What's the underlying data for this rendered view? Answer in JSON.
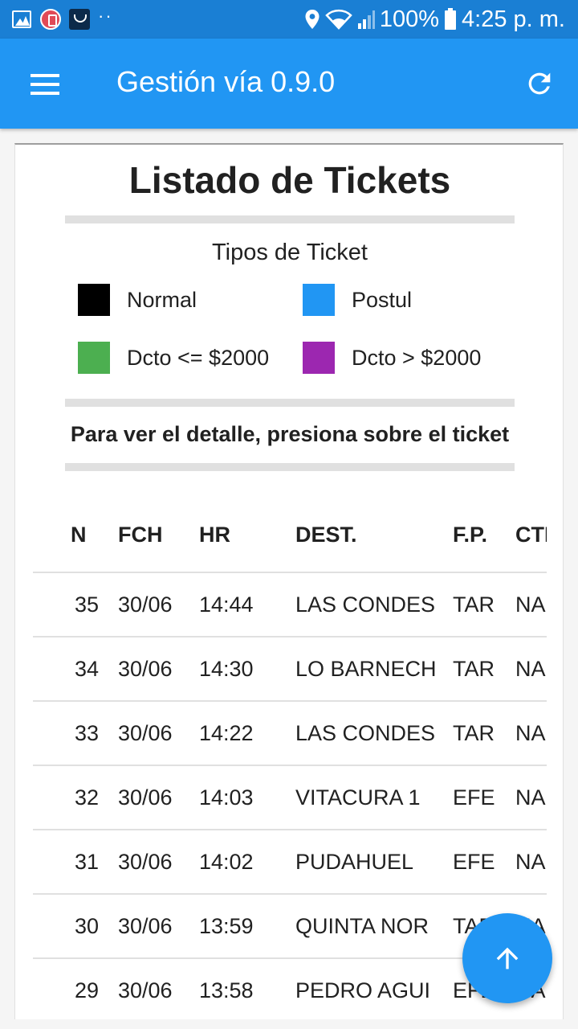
{
  "status_bar": {
    "battery": "100%",
    "time": "4:25 p. m.",
    "icons": [
      "image-icon",
      "notification-app-icon",
      "bag-app-icon",
      "more-dots-icon",
      "location-icon",
      "wifi-icon",
      "signal-icon",
      "battery-icon"
    ]
  },
  "app_bar": {
    "title": "Gestión vía 0.9.0",
    "menu_icon": "hamburger-icon",
    "refresh_icon": "refresh-icon"
  },
  "page": {
    "title": "Listado de Tickets",
    "types_title": "Tipos de Ticket",
    "instruction": "Para ver el detalle, presiona sobre el ticket"
  },
  "legend": [
    {
      "label": "Normal",
      "color": "#000000"
    },
    {
      "label": "Postul",
      "color": "#2196f3"
    },
    {
      "label": "Dcto <= $2000",
      "color": "#4caf50"
    },
    {
      "label": "Dcto > $2000",
      "color": "#9c27b0"
    }
  ],
  "table": {
    "headers": {
      "n": "N",
      "fch": "FCH",
      "hr": "HR",
      "dest": "DEST.",
      "fp": "F.P.",
      "ct": "CTI"
    },
    "rows": [
      {
        "n": "35",
        "fch": "30/06",
        "hr": "14:44",
        "dest": "LAS CONDES",
        "fp": "TAR",
        "ct": "NA"
      },
      {
        "n": "34",
        "fch": "30/06",
        "hr": "14:30",
        "dest": "LO BARNECH",
        "fp": "TAR",
        "ct": "NA"
      },
      {
        "n": "33",
        "fch": "30/06",
        "hr": "14:22",
        "dest": "LAS CONDES",
        "fp": "TAR",
        "ct": "NA"
      },
      {
        "n": "32",
        "fch": "30/06",
        "hr": "14:03",
        "dest": "VITACURA 1",
        "fp": "EFE",
        "ct": "NA"
      },
      {
        "n": "31",
        "fch": "30/06",
        "hr": "14:02",
        "dest": "PUDAHUEL",
        "fp": "EFE",
        "ct": "NA"
      },
      {
        "n": "30",
        "fch": "30/06",
        "hr": "13:59",
        "dest": "QUINTA NOR",
        "fp": "TAR",
        "ct": "NA"
      },
      {
        "n": "29",
        "fch": "30/06",
        "hr": "13:58",
        "dest": "PEDRO AGUI",
        "fp": "EFE",
        "ct": "NA"
      }
    ]
  },
  "fab": {
    "icon": "arrow-up-icon"
  }
}
